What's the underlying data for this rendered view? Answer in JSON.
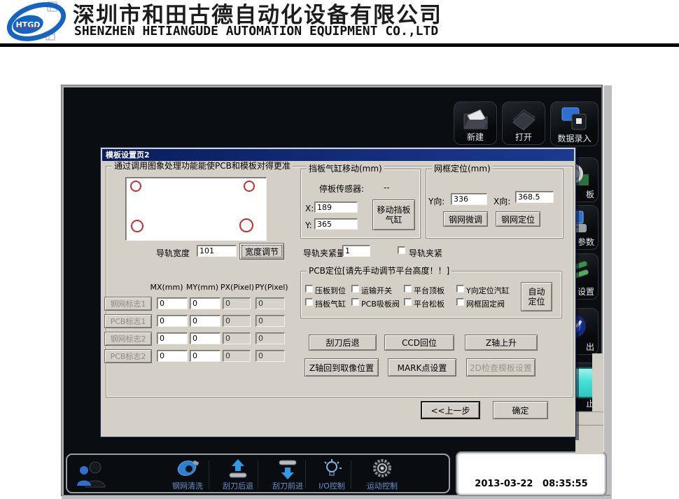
{
  "header": {
    "logo_text": "HTGD",
    "company_cn": "深圳市和田古德自动化设备有限公司",
    "company_en": "SHENZHEN HETIANGUDE AUTOMATION EQUIPMENT CO.,LTD"
  },
  "nav": {
    "top_buttons": [
      {
        "label": "新建"
      },
      {
        "label": "打开"
      },
      {
        "label": "数据录入"
      }
    ],
    "side_buttons_partially_visible": [
      {
        "label_visible": "板"
      },
      {
        "label_visible": "参数"
      },
      {
        "label_visible": "设置"
      },
      {
        "label_visible": "出"
      },
      {
        "label_visible": "止"
      }
    ]
  },
  "dialog": {
    "title": "模板设置页2",
    "main_group_label": "通过调用图象处理功能能使PCB和模板对得更准",
    "rail": {
      "width_label": "导轨宽度",
      "width_value": "101",
      "adjust_button": "宽度调节",
      "clamp_amount_label": "导轨夹紧量:",
      "clamp_amount_value": "1",
      "clamp_checkbox_label": "导轨夹紧"
    },
    "baffle_group": {
      "title": "挡板气缸移动(mm)",
      "sensor_label": "停板传感器:",
      "sensor_value": "--",
      "x_label": "X:",
      "x_value": "189",
      "y_label": "Y:",
      "y_value": "365",
      "move_button_line1": "移动挡板",
      "move_button_line2": "气缸"
    },
    "frame_group": {
      "title": "网框定位(mm)",
      "y_label": "Y向:",
      "y_value": "336",
      "x_label": "X向:",
      "x_value": "368.5",
      "fine_tune_button": "钢网微调",
      "position_button": "钢网定位"
    },
    "pcb_group": {
      "title": "PCB定位[请先手动调节平台高度！！]",
      "row1": [
        {
          "label": "压板到位",
          "checked": false
        },
        {
          "label": "运输开关",
          "checked": false
        },
        {
          "label": "平台顶板",
          "checked": false
        },
        {
          "label": "Y向定位汽缸",
          "checked": false
        }
      ],
      "row2": [
        {
          "label": "挡板气缸",
          "checked": false
        },
        {
          "label": "PCB吸板阀",
          "checked": false
        },
        {
          "label": "平台松板",
          "checked": false
        },
        {
          "label": "网框固定阀",
          "checked": false
        }
      ],
      "auto_button_line1": "自动",
      "auto_button_line2": "定位"
    },
    "mark_table": {
      "headers": [
        "MX(mm)",
        "MY(mm)",
        "PX(Pixel)",
        "PY(Pixel)"
      ],
      "rows": [
        {
          "label": "钢网标志1",
          "mx": "0",
          "my": "0",
          "px": "0",
          "py": "0"
        },
        {
          "label": "PCB标志1",
          "mx": "0",
          "my": "0",
          "px": "0",
          "py": "0"
        },
        {
          "label": "钢网标志2",
          "mx": "0",
          "my": "0",
          "px": "0",
          "py": "0"
        },
        {
          "label": "PCB标志2",
          "mx": "0",
          "my": "0",
          "px": "0",
          "py": "0"
        }
      ]
    },
    "action_buttons": {
      "squeegee_back": "刮刀后退",
      "ccd_return": "CCD回位",
      "z_up": "Z轴上升",
      "z_to_capture": "Z轴回到取像位置",
      "mark_setting": "MARK点设置",
      "check_2d": "2D检查模板设置"
    },
    "footer": {
      "prev_button": "<<上一步",
      "ok_button": "确定"
    }
  },
  "toolbar": {
    "items": [
      {
        "label": "钢网清洗"
      },
      {
        "label": "刮刀后退"
      },
      {
        "label": "刮刀前进"
      },
      {
        "label": "I/O控制"
      },
      {
        "label": "运动控制"
      }
    ]
  },
  "status": {
    "datetime": "2013-03-22   08:35:55"
  },
  "colors": {
    "title_bar": "#0a246a",
    "dialog_bg": "#d4d0c8",
    "window_bg": "#0b0e11",
    "accent_blue": "#2f7fd0",
    "marker_red": "#c23030",
    "stop_cyan": "#45e0d6"
  }
}
